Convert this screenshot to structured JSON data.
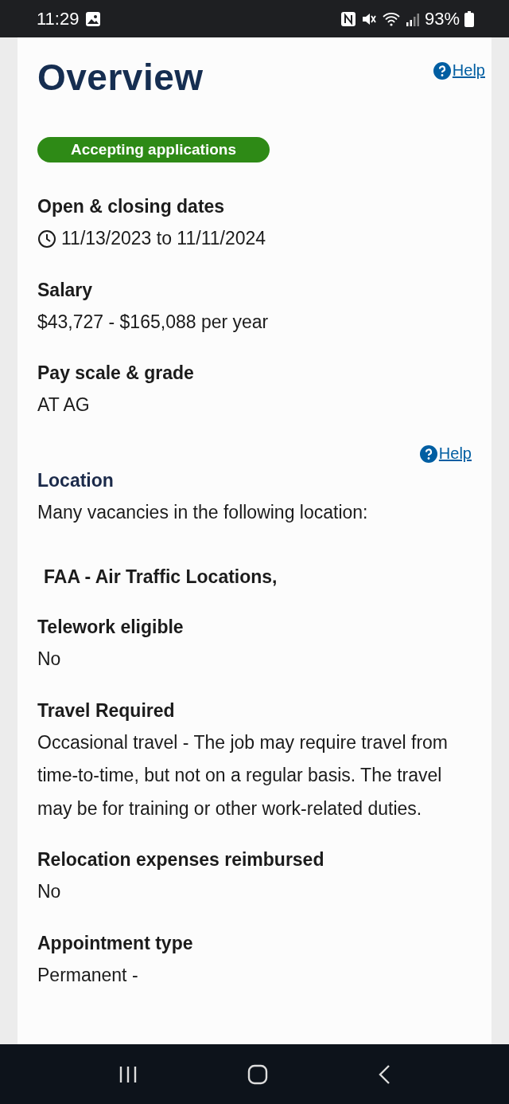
{
  "status_bar": {
    "time": "11:29",
    "battery": "93%"
  },
  "overview": {
    "title": "Overview",
    "help": "Help",
    "status_badge": "Accepting applications"
  },
  "sections": [
    {
      "kind": "dates",
      "heading": "Open & closing dates",
      "value": "11/13/2023 to 11/11/2024"
    },
    {
      "kind": "plain",
      "heading": "Salary",
      "value": "$43,727 - $165,088 per year"
    },
    {
      "kind": "plain",
      "heading": "Pay scale & grade",
      "value": "AT AG"
    },
    {
      "kind": "location",
      "help": "Help",
      "heading": "Location",
      "value": "Many vacancies in the following location:",
      "detail": "FAA - Air Traffic Locations,"
    },
    {
      "kind": "plain",
      "heading": "Telework eligible",
      "value": "No"
    },
    {
      "kind": "plain",
      "heading": "Travel Required",
      "value": "Occasional travel - The job may require travel from time-to-time, but not on a regular basis. The travel may be for training or other work-related duties."
    },
    {
      "kind": "plain",
      "heading": "Relocation expenses reimbursed",
      "value": "No"
    },
    {
      "kind": "plain",
      "heading": "Appointment type",
      "value": "Permanent -"
    }
  ]
}
